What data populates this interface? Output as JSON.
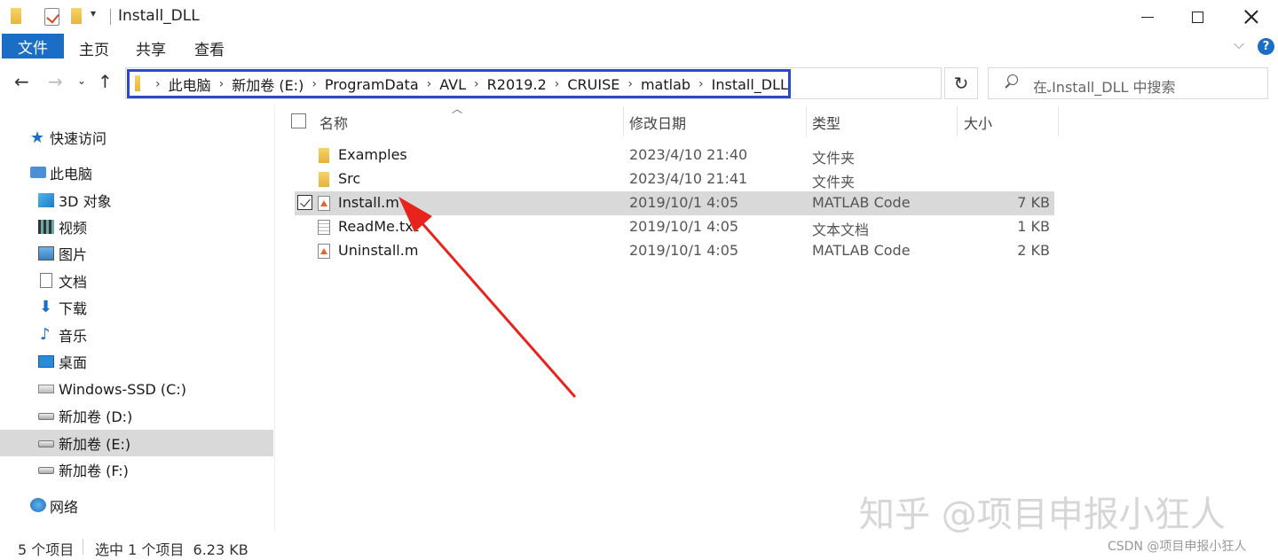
{
  "window": {
    "title": "Install_DLL",
    "quick_access_dropdown": "▾"
  },
  "ribbon": {
    "tabs": [
      "文件",
      "主页",
      "共享",
      "查看"
    ],
    "help": "?"
  },
  "address": {
    "crumbs": [
      "此电脑",
      "新加卷 (E:)",
      "ProgramData",
      "AVL",
      "R2019.2",
      "CRUISE",
      "matlab",
      "Install_DLL"
    ],
    "highlight_color": "#2f47c9"
  },
  "search": {
    "placeholder": "在 Install_DLL 中搜索"
  },
  "sidebar": {
    "items": [
      {
        "label": "快速访问",
        "icon": "star-icon"
      },
      {
        "label": "此电脑",
        "icon": "computer-icon"
      },
      {
        "label": "3D 对象",
        "icon": "3d-objects-icon"
      },
      {
        "label": "视频",
        "icon": "video-icon"
      },
      {
        "label": "图片",
        "icon": "pictures-icon"
      },
      {
        "label": "文档",
        "icon": "documents-icon"
      },
      {
        "label": "下载",
        "icon": "download-icon"
      },
      {
        "label": "音乐",
        "icon": "music-icon"
      },
      {
        "label": "桌面",
        "icon": "desktop-icon"
      },
      {
        "label": "Windows-SSD (C:)",
        "icon": "windows-drive-icon"
      },
      {
        "label": "新加卷 (D:)",
        "icon": "drive-icon"
      },
      {
        "label": "新加卷 (E:)",
        "icon": "drive-icon",
        "selected": true
      },
      {
        "label": "新加卷 (F:)",
        "icon": "drive-icon"
      },
      {
        "label": "网络",
        "icon": "network-icon"
      }
    ]
  },
  "columns": {
    "name": "名称",
    "modified": "修改日期",
    "type": "类型",
    "size": "大小"
  },
  "files": [
    {
      "name": "Examples",
      "modified": "2023/4/10 21:40",
      "type": "文件夹",
      "size": "",
      "icon": "folder-icon"
    },
    {
      "name": "Src",
      "modified": "2023/4/10 21:41",
      "type": "文件夹",
      "size": "",
      "icon": "folder-icon"
    },
    {
      "name": "Install.m",
      "modified": "2019/10/1 4:05",
      "type": "MATLAB Code",
      "size": "7 KB",
      "icon": "matlab-file-icon",
      "selected": true
    },
    {
      "name": "ReadMe.txt",
      "modified": "2019/10/1 4:05",
      "type": "文本文档",
      "size": "1 KB",
      "icon": "text-file-icon"
    },
    {
      "name": "Uninstall.m",
      "modified": "2019/10/1 4:05",
      "type": "MATLAB Code",
      "size": "2 KB",
      "icon": "matlab-file-icon"
    }
  ],
  "status": {
    "item_count": "5 个项目",
    "selection": "选中 1 个项目  6.23 KB"
  },
  "annotation": {
    "arrow_color": "#e8221c"
  },
  "watermark": {
    "zhihu": "知乎 @项目申报小狂人",
    "csdn": "CSDN @项目申报小狂人"
  }
}
